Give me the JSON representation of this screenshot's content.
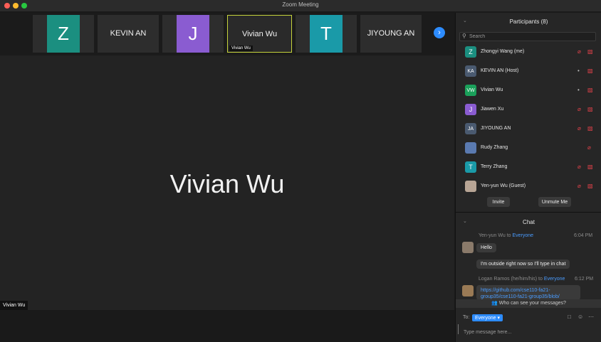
{
  "window": {
    "title": "Zoom Meeting"
  },
  "gallery": {
    "tiles": [
      {
        "letter": "Z",
        "color": "#1b8f80"
      },
      {
        "name": "KEVIN AN"
      },
      {
        "letter": "J",
        "color": "#8a5cd1"
      },
      {
        "name": "Vivian Wu",
        "tag": "Vivian Wu"
      },
      {
        "letter": "T",
        "color": "#1a9aa8"
      },
      {
        "name": "JIYOUNG AN"
      }
    ],
    "next_icon": "chevron-right-icon"
  },
  "speaker": {
    "name": "Vivian Wu",
    "tag": "Vivian Wu"
  },
  "participants": {
    "title": "Participants (8)",
    "search_placeholder": "Search",
    "list": [
      {
        "initials": "Z",
        "name": "Zhongyi Wang (me)",
        "color": "#1b8f80",
        "mic": "muted",
        "cam": "off"
      },
      {
        "initials": "KA",
        "name": "KEVIN AN (Host)",
        "color": "#4a5a70",
        "mic": "on",
        "cam": "off"
      },
      {
        "initials": "VW",
        "name": "Vivian Wu",
        "color": "#1aa05a",
        "mic": "on",
        "cam": "off"
      },
      {
        "initials": "J",
        "name": "Jiawen Xu",
        "color": "#8a5cd1",
        "mic": "muted",
        "cam": "off"
      },
      {
        "initials": "JA",
        "name": "JIYOUNG AN",
        "color": "#4a5a70",
        "mic": "muted",
        "cam": "off"
      },
      {
        "initials": "",
        "name": "Rudy Zhang",
        "color": "#5a7ab0",
        "mic": "muted",
        "cam": "none"
      },
      {
        "initials": "T",
        "name": "Terry Zhang",
        "color": "#1a9aa8",
        "mic": "muted",
        "cam": "off"
      },
      {
        "initials": "",
        "name": "Yen-yun Wu (Guest)",
        "color": "#b8a595",
        "mic": "muted",
        "cam": "off"
      }
    ],
    "invite_label": "Invite",
    "unmute_label": "Unmute Me"
  },
  "chat": {
    "title": "Chat",
    "messages": [
      {
        "sender": "Yen-yun Wu",
        "to_word": "to",
        "recipient": "Everyone",
        "time": "6:04 PM",
        "texts": [
          "Hello",
          "I'm outside right now so I'll type in chat"
        ]
      },
      {
        "sender": "Logan Ramos (he/him/his)",
        "to_word": "to",
        "recipient": "Everyone",
        "time": "6:12 PM",
        "texts": [
          "https://github.com/cse110-fa21-group35/cse110-fa21-group35/blob/"
        ]
      }
    ],
    "who_can_see": "Who can see your messages?",
    "to_label": "To:",
    "to_value": "Everyone",
    "input_placeholder": "Type message here...",
    "colors": {
      "accent": "#2d8cff",
      "muted_red": "#e0424a"
    }
  }
}
